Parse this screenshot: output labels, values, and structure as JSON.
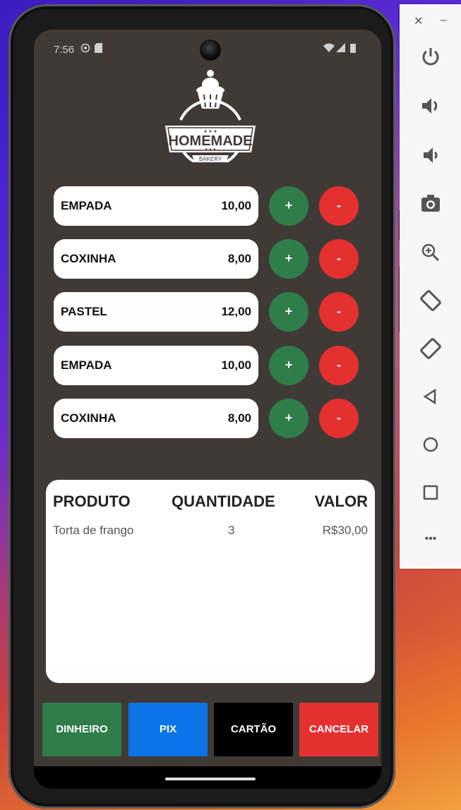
{
  "status_bar": {
    "time": "7:56"
  },
  "brand": {
    "name": "HOMEMADE",
    "sub": "BAKERY"
  },
  "products": [
    {
      "name": "EMPADA",
      "price": "10,00",
      "plus": "+",
      "minus": "-"
    },
    {
      "name": "COXINHA",
      "price": "8,00",
      "plus": "+",
      "minus": "-"
    },
    {
      "name": "PASTEL",
      "price": "12,00",
      "plus": "+",
      "minus": "-"
    },
    {
      "name": "EMPADA",
      "price": "10,00",
      "plus": "+",
      "minus": "-"
    },
    {
      "name": "COXINHA",
      "price": "8,00",
      "plus": "+",
      "minus": "-"
    }
  ],
  "summary": {
    "headers": [
      "PRODUTO",
      "QUANTIDADE",
      "VALOR"
    ],
    "rows": [
      {
        "product": "Torta de frango",
        "quantity": "3",
        "value": "R$30,00"
      }
    ]
  },
  "payment_buttons": [
    {
      "label": "DINHEIRO",
      "color": "#2e7d4a"
    },
    {
      "label": "PIX",
      "color": "#0a74e8"
    },
    {
      "label": "CARTÃO",
      "color": "#000000"
    },
    {
      "label": "CANCELAR",
      "color": "#e53030"
    }
  ],
  "emulator_controls": {
    "window": [
      "close",
      "minimize"
    ],
    "icons": [
      "power-icon",
      "volume-up-icon",
      "volume-down-icon",
      "camera-icon",
      "zoom-icon",
      "rotate-left-icon",
      "rotate-right-icon",
      "back-icon",
      "home-icon",
      "overview-icon",
      "more-icon"
    ],
    "more_label": "•••"
  },
  "colors": {
    "app_background": "#403a37",
    "add": "#2e7d4a",
    "remove": "#e53030"
  }
}
